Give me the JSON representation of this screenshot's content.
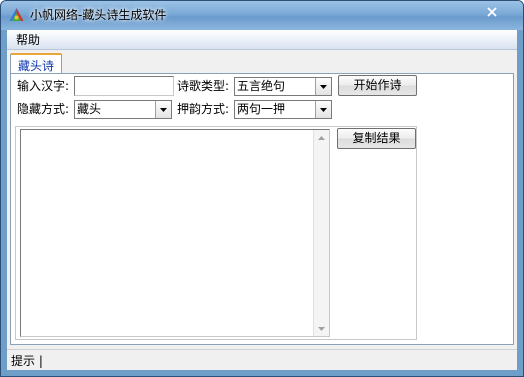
{
  "window": {
    "title": "小帆网络-藏头诗生成软件",
    "icon": "app-logo-icon",
    "close_icon": "close-icon"
  },
  "menu": {
    "items": [
      {
        "label": "帮助"
      }
    ]
  },
  "tabs": [
    {
      "label": "藏头诗",
      "active": true
    }
  ],
  "form": {
    "input_chars": {
      "label": "输入汉字:",
      "value": ""
    },
    "poem_type": {
      "label": "诗歌类型:",
      "value": "五言绝句"
    },
    "hide_mode": {
      "label": "隐藏方式:",
      "value": "藏头"
    },
    "rhyme_mode": {
      "label": "押韵方式:",
      "value": "两句一押"
    },
    "start_button": "开始作诗",
    "copy_button": "复制结果",
    "result_text": ""
  },
  "status": {
    "text": "提示 |"
  },
  "colors": {
    "tab_accent": "#e8a63a",
    "tab_label": "#0b37b0",
    "title_bar": "#7aa9d6"
  }
}
